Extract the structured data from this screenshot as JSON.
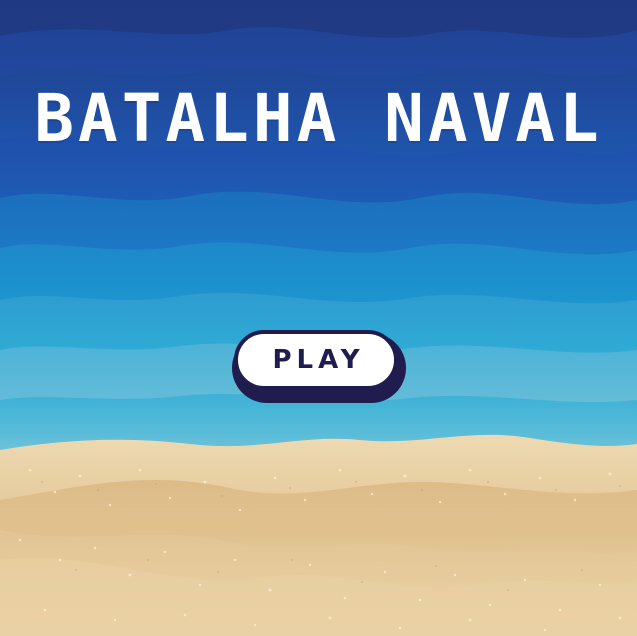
{
  "game": {
    "title": "BATALHA NAVAL",
    "play_label": "PLAY"
  },
  "colors": {
    "sea_deep": "#1f3f8f",
    "sea_mid": "#1d8fd0",
    "sea_shallow": "#7fc6dc",
    "sky_haze": "#b9cfdc",
    "sand": "#e4c99b",
    "button_outline": "#211c4e",
    "button_fill": "#ffffff"
  }
}
